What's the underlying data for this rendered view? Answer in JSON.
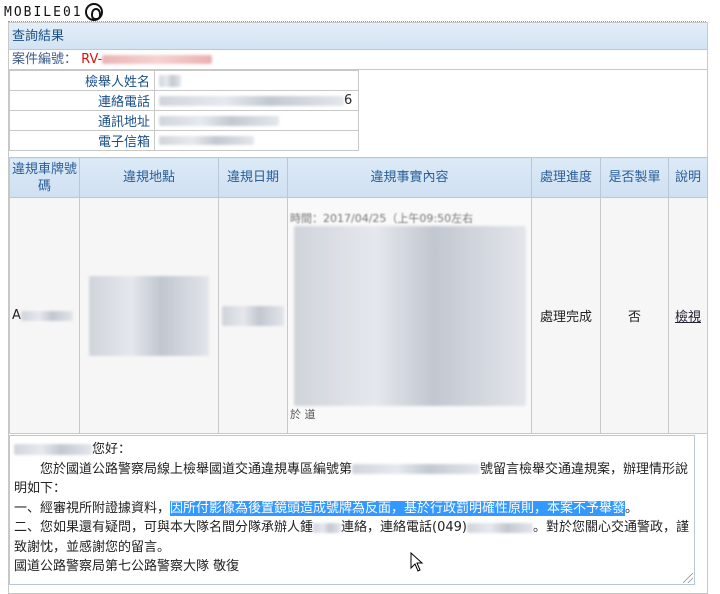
{
  "watermark": {
    "text": "MOBILE01"
  },
  "section": {
    "title": "查詢結果"
  },
  "case": {
    "label": "案件編號：",
    "number_prefix": "RV-"
  },
  "reporter": {
    "name_label": "檢舉人姓名",
    "phone_label": "連絡電話",
    "address_label": "通訊地址",
    "email_label": "電子信箱",
    "phone_visible_tail": "6"
  },
  "table": {
    "headers": [
      "違規車牌號碼",
      "違規地點",
      "違規日期",
      "違規事實內容",
      "處理進度",
      "是否製單",
      "說明"
    ],
    "row": {
      "plate_prefix": "A",
      "status": "處理完成",
      "ticket_issued": "否",
      "view_link": "檢視",
      "content_fragment_1": "時間：2017/04/25（",
      "content_fragment_2": "上午09:50左右",
      "content_fragment_3": "於",
      "content_fragment_4": "道"
    }
  },
  "reply": {
    "greeting_suffix": "您好：",
    "line1_a": "您於國道公路警察局線上檢舉國道交通違規專區編號第",
    "line1_b": "號留言檢舉交通違規案，辦理情形說明如下：",
    "line2_a": "一、經審視所附證據資料，",
    "line2_highlight": "因所付影像為後置鏡頭造成號牌為反面，基於行政罰明確性原則，本案不予舉發",
    "line2_end": "。",
    "line3_a": "二、您如果還有疑問，可與本大隊名間分隊承辦人鍾",
    "line3_b": "連絡，連絡電話(049)",
    "line3_c": "。對於您關心交通警政，謹致謝忱，並感謝您的留言。",
    "signature": "國道公路警察局第七公路警察大隊  敬復"
  },
  "colors": {
    "header_text": "#2a5e98",
    "case_number": "#dd1111",
    "highlight": "#3399ff"
  }
}
